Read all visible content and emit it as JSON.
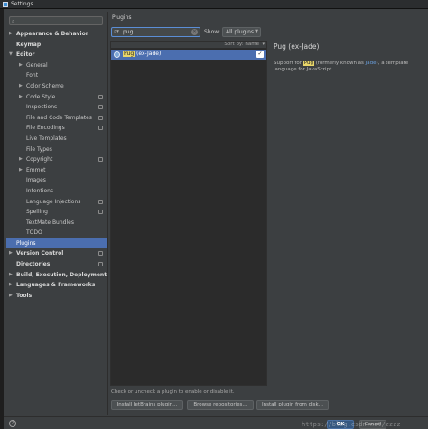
{
  "window": {
    "title": "Settings"
  },
  "left": {
    "search": {
      "icon": "search-icon",
      "value": ""
    },
    "tree": [
      {
        "label": "Appearance & Behavior",
        "bold": true,
        "arrow": "▶",
        "indent": 0,
        "project": false
      },
      {
        "label": "Keymap",
        "bold": true,
        "arrow": "",
        "indent": 0,
        "project": false
      },
      {
        "label": "Editor",
        "bold": true,
        "arrow": "▼",
        "indent": 0,
        "project": false
      },
      {
        "label": "General",
        "bold": false,
        "arrow": "▶",
        "indent": 1,
        "project": false
      },
      {
        "label": "Font",
        "bold": false,
        "arrow": "",
        "indent": 1,
        "project": false
      },
      {
        "label": "Color Scheme",
        "bold": false,
        "arrow": "▶",
        "indent": 1,
        "project": false
      },
      {
        "label": "Code Style",
        "bold": false,
        "arrow": "▶",
        "indent": 1,
        "project": true
      },
      {
        "label": "Inspections",
        "bold": false,
        "arrow": "",
        "indent": 1,
        "project": true
      },
      {
        "label": "File and Code Templates",
        "bold": false,
        "arrow": "",
        "indent": 1,
        "project": true
      },
      {
        "label": "File Encodings",
        "bold": false,
        "arrow": "",
        "indent": 1,
        "project": true
      },
      {
        "label": "Live Templates",
        "bold": false,
        "arrow": "",
        "indent": 1,
        "project": false
      },
      {
        "label": "File Types",
        "bold": false,
        "arrow": "",
        "indent": 1,
        "project": false
      },
      {
        "label": "Copyright",
        "bold": false,
        "arrow": "▶",
        "indent": 1,
        "project": true
      },
      {
        "label": "Emmet",
        "bold": false,
        "arrow": "▶",
        "indent": 1,
        "project": false
      },
      {
        "label": "Images",
        "bold": false,
        "arrow": "",
        "indent": 1,
        "project": false
      },
      {
        "label": "Intentions",
        "bold": false,
        "arrow": "",
        "indent": 1,
        "project": false
      },
      {
        "label": "Language Injections",
        "bold": false,
        "arrow": "",
        "indent": 1,
        "project": true
      },
      {
        "label": "Spelling",
        "bold": false,
        "arrow": "",
        "indent": 1,
        "project": true
      },
      {
        "label": "TextMate Bundles",
        "bold": false,
        "arrow": "",
        "indent": 1,
        "project": false
      },
      {
        "label": "TODO",
        "bold": false,
        "arrow": "",
        "indent": 1,
        "project": false
      },
      {
        "label": "Plugins",
        "bold": false,
        "arrow": "",
        "indent": 0,
        "project": false,
        "selected": true
      },
      {
        "label": "Version Control",
        "bold": true,
        "arrow": "▶",
        "indent": 0,
        "project": true
      },
      {
        "label": "Directories",
        "bold": true,
        "arrow": "",
        "indent": 0,
        "project": true
      },
      {
        "label": "Build, Execution, Deployment",
        "bold": true,
        "arrow": "▶",
        "indent": 0,
        "project": false
      },
      {
        "label": "Languages & Frameworks",
        "bold": true,
        "arrow": "▶",
        "indent": 0,
        "project": false
      },
      {
        "label": "Tools",
        "bold": true,
        "arrow": "▶",
        "indent": 0,
        "project": false
      }
    ]
  },
  "plugins": {
    "title": "Plugins",
    "search": {
      "value": "pug",
      "icon": "search-icon"
    },
    "show_label": "Show:",
    "show_value": "All plugins",
    "sort_label": "Sort by: name",
    "list": [
      {
        "name_highlight": "Pug",
        "name_rest": " (ex-Jade)",
        "checked": true
      }
    ],
    "details": {
      "name": "Pug (ex-Jade)",
      "desc_pre": "Support for ",
      "desc_hl": "Pug",
      "desc_mid": " (formerly known as ",
      "desc_link": "Jade",
      "desc_post": "), a template language for JavaScript"
    },
    "hint": "Check or uncheck a plugin to enable or disable it.",
    "buttons": {
      "install_jb": "Install JetBrains plugin...",
      "browse": "Browse repositories...",
      "install_disk": "Install plugin from disk..."
    }
  },
  "footer": {
    "ok": "OK",
    "cancel": "Cancel",
    "watermark": "https://blog.csdn.net/zzzz"
  },
  "colors": {
    "accent": "#4b6eaf",
    "highlight": "#e8d66a",
    "link": "#6a9fdd"
  }
}
